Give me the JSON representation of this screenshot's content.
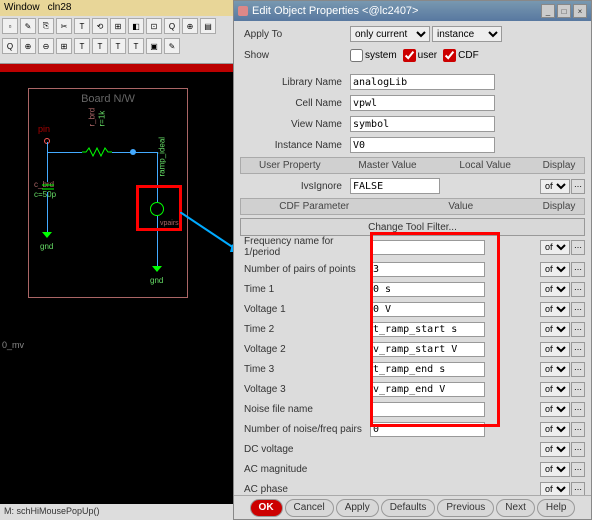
{
  "bg": {
    "menu": {
      "window": "Window",
      "cln28": "cln28"
    },
    "board_title": "Board N/W",
    "pin": "pin",
    "r_brd": "r_brd",
    "r_val": "r=1k",
    "c_brd": "c_brd",
    "c_val": "c=50p",
    "ramp_ideal": "ramp_ideal",
    "vpairs": "vpairs",
    "gnd": "gnd",
    "gnd2": "gnd",
    "axis_y": "0_mv",
    "status": "M: schHiMousePopUp()"
  },
  "dialog": {
    "title": "Edit Object Properties <@lc2407>",
    "apply_to_lbl": "Apply To",
    "apply_sel1": "only current",
    "apply_sel2": "instance",
    "show_lbl": "Show",
    "show_system": "system",
    "show_user": "user",
    "show_cdf": "CDF",
    "lib_lbl": "Library Name",
    "lib_val": "analogLib",
    "cell_lbl": "Cell Name",
    "cell_val": "vpwl",
    "view_lbl": "View Name",
    "view_val": "symbol",
    "inst_lbl": "Instance Name",
    "inst_val": "V0",
    "hdr_user": "User Property",
    "hdr_master": "Master Value",
    "hdr_local": "Local Value",
    "hdr_display": "Display",
    "ivs_lbl": "IvsIgnore",
    "ivs_val": "FALSE",
    "hdr_cdf": "CDF Parameter",
    "hdr_value": "Value",
    "tool_filter": "Change Tool Filter...",
    "params": [
      {
        "label": "Frequency name for 1/period",
        "value": ""
      },
      {
        "label": "Number of pairs of points",
        "value": "3"
      },
      {
        "label": "Time 1",
        "value": "0 s"
      },
      {
        "label": "Voltage 1",
        "value": "0 V"
      },
      {
        "label": "Time 2",
        "value": "t_ramp_start s"
      },
      {
        "label": "Voltage 2",
        "value": "v_ramp_start V"
      },
      {
        "label": "Time 3",
        "value": "t_ramp_end s"
      },
      {
        "label": "Voltage 3",
        "value": "v_ramp_end V"
      },
      {
        "label": "Noise file name",
        "value": ""
      },
      {
        "label": "Number of noise/freq pairs",
        "value": "0"
      },
      {
        "label": "DC voltage",
        "value": ""
      },
      {
        "label": "AC magnitude",
        "value": ""
      },
      {
        "label": "AC phase",
        "value": ""
      }
    ],
    "off": "off",
    "buttons": {
      "ok": "OK",
      "cancel": "Cancel",
      "apply": "Apply",
      "defaults": "Defaults",
      "previous": "Previous",
      "next": "Next",
      "help": "Help"
    }
  }
}
